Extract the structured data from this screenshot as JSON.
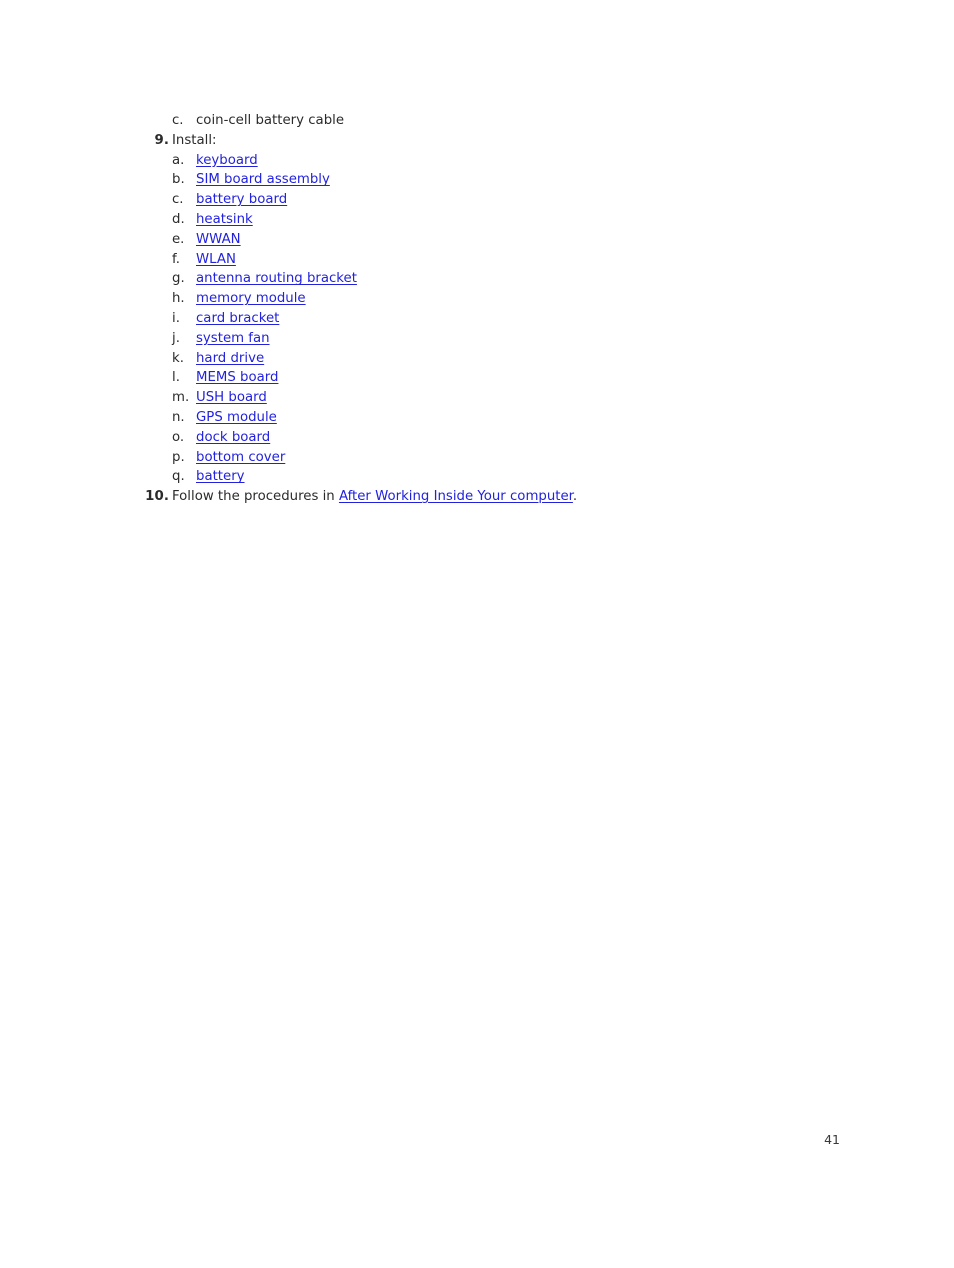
{
  "document": {
    "page_number": "41",
    "link_color": "#2222dd",
    "text_color": "#2b2b2b"
  },
  "steps": [
    {
      "type": "sub",
      "marker": "c.",
      "label": "coin-cell battery cable",
      "is_link": false
    },
    {
      "type": "main",
      "marker": "9.",
      "label": "Install:",
      "is_link": false
    },
    {
      "type": "sub",
      "marker": "a.",
      "label": "keyboard",
      "is_link": true
    },
    {
      "type": "sub",
      "marker": "b.",
      "label": "SIM board assembly",
      "is_link": true
    },
    {
      "type": "sub",
      "marker": "c.",
      "label": "battery board",
      "is_link": true
    },
    {
      "type": "sub",
      "marker": "d.",
      "label": "heatsink",
      "is_link": true
    },
    {
      "type": "sub",
      "marker": "e.",
      "label": "WWAN",
      "is_link": true
    },
    {
      "type": "sub",
      "marker": "f.",
      "label": "WLAN",
      "is_link": true
    },
    {
      "type": "sub",
      "marker": "g.",
      "label": "antenna routing bracket",
      "is_link": true
    },
    {
      "type": "sub",
      "marker": "h.",
      "label": "memory module",
      "is_link": true
    },
    {
      "type": "sub",
      "marker": "i.",
      "label": "card bracket",
      "is_link": true
    },
    {
      "type": "sub",
      "marker": "j.",
      "label": "system fan",
      "is_link": true
    },
    {
      "type": "sub",
      "marker": "k.",
      "label": "hard drive",
      "is_link": true
    },
    {
      "type": "sub",
      "marker": "l.",
      "label": "MEMS board",
      "is_link": true
    },
    {
      "type": "sub",
      "marker": "m.",
      "label": "USH board",
      "is_link": true
    },
    {
      "type": "sub",
      "marker": "n.",
      "label": "GPS module",
      "is_link": true
    },
    {
      "type": "sub",
      "marker": "o.",
      "label": "dock board",
      "is_link": true
    },
    {
      "type": "sub",
      "marker": "p.",
      "label": "bottom cover",
      "is_link": true
    },
    {
      "type": "sub",
      "marker": "q.",
      "label": "battery",
      "is_link": true
    },
    {
      "type": "main",
      "marker": "10.",
      "prefix": "Follow the procedures in ",
      "link": "After Working Inside Your computer",
      "suffix": ".",
      "is_link": false
    }
  ]
}
